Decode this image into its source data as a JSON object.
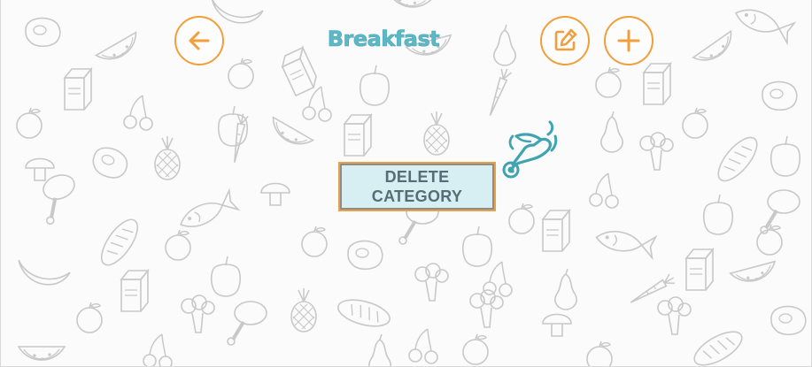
{
  "header": {
    "title": "Breakfast",
    "back_icon": "arrow-left-icon",
    "edit_icon": "edit-pencil-icon",
    "add_icon": "plus-icon"
  },
  "main": {
    "delete_category_label": "DELETE CATEGORY",
    "hint_icon": "pointing-hand-icon"
  },
  "colors": {
    "accent": "#f29e3a",
    "title": "#5bb8c4",
    "button_bg": "#d7eef3",
    "button_text": "#576d76",
    "pattern": "#c8c8c8"
  }
}
